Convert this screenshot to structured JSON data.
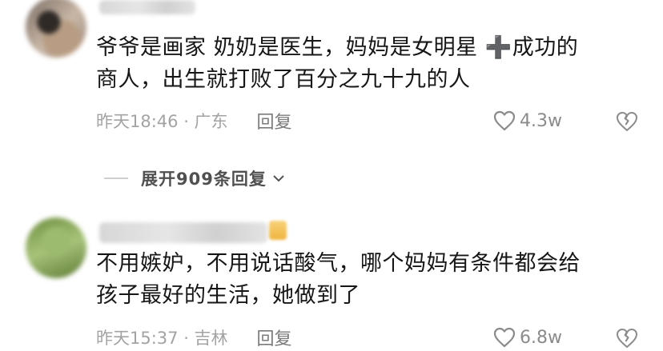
{
  "comments": [
    {
      "text_lines": [
        "爷爷是画家 奶奶是医生，妈妈是女明星 ➕成功的",
        "商人，出生就打败了百分之九十九的人"
      ],
      "meta": "昨天18:46 · 广东",
      "reply_label": "回复",
      "likes": "4.3w",
      "avatar_icon": "user-avatar-blurred",
      "expand_label": "展开909条回复"
    },
    {
      "text_lines": [
        "不用嫉妒，不用说话酸气，哪个妈妈有条件都会给",
        "孩子最好的生活，她做到了"
      ],
      "meta": "昨天15:37 · 吉林",
      "reply_label": "回复",
      "likes": "6.8w",
      "avatar_icon": "user-avatar-blurred"
    }
  ],
  "icons": {
    "like": "heart-outline-icon",
    "dislike": "broken-heart-icon",
    "expand": "chevron-down-icon"
  },
  "colors": {
    "text": "#161616",
    "meta": "#a3a3a3",
    "icon": "#8b8b8b"
  }
}
